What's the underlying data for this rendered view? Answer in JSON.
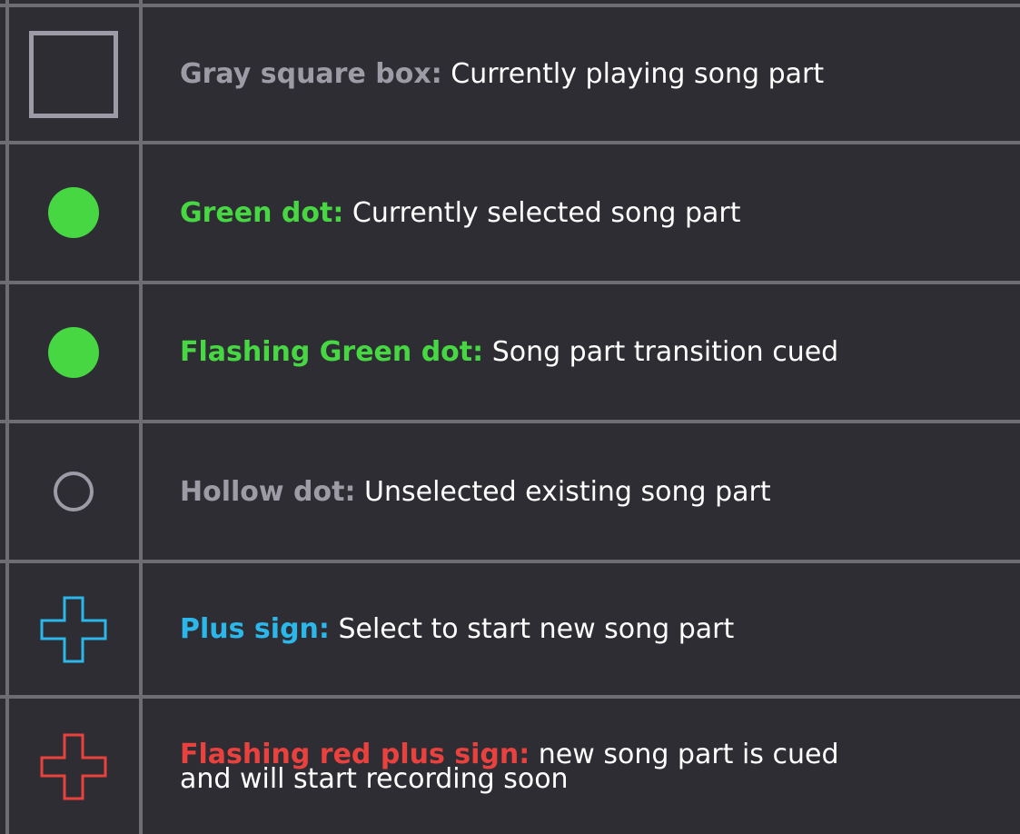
{
  "colors": {
    "background": "#2e2d33",
    "grid_line": "#6e6e72",
    "gray": "#9d9ca6",
    "green": "#46d742",
    "blue": "#2bb7ea",
    "red": "#e9413e",
    "text": "#ffffff"
  },
  "rows": [
    {
      "icon": "gray-square-box-icon",
      "label": "Gray square box:",
      "description": "Currently playing song part",
      "label_color": "#9d9ca6"
    },
    {
      "icon": "green-dot-icon",
      "label": "Green dot:",
      "description": "Currently selected song part",
      "label_color": "#46d742"
    },
    {
      "icon": "flashing-green-dot-icon",
      "label": "Flashing Green dot:",
      "description": "Song part transition cued",
      "label_color": "#46d742"
    },
    {
      "icon": "hollow-dot-icon",
      "label": "Hollow dot:",
      "description": "Unselected existing song part",
      "label_color": "#9d9ca6"
    },
    {
      "icon": "blue-plus-sign-icon",
      "label": "Plus sign:",
      "description": "Select to start new song part",
      "label_color": "#2bb7ea"
    },
    {
      "icon": "red-plus-sign-icon",
      "label": "Flashing red plus sign:",
      "description": "new song part is cued",
      "description_line2": "and will start recording soon",
      "label_color": "#e9413e"
    }
  ]
}
